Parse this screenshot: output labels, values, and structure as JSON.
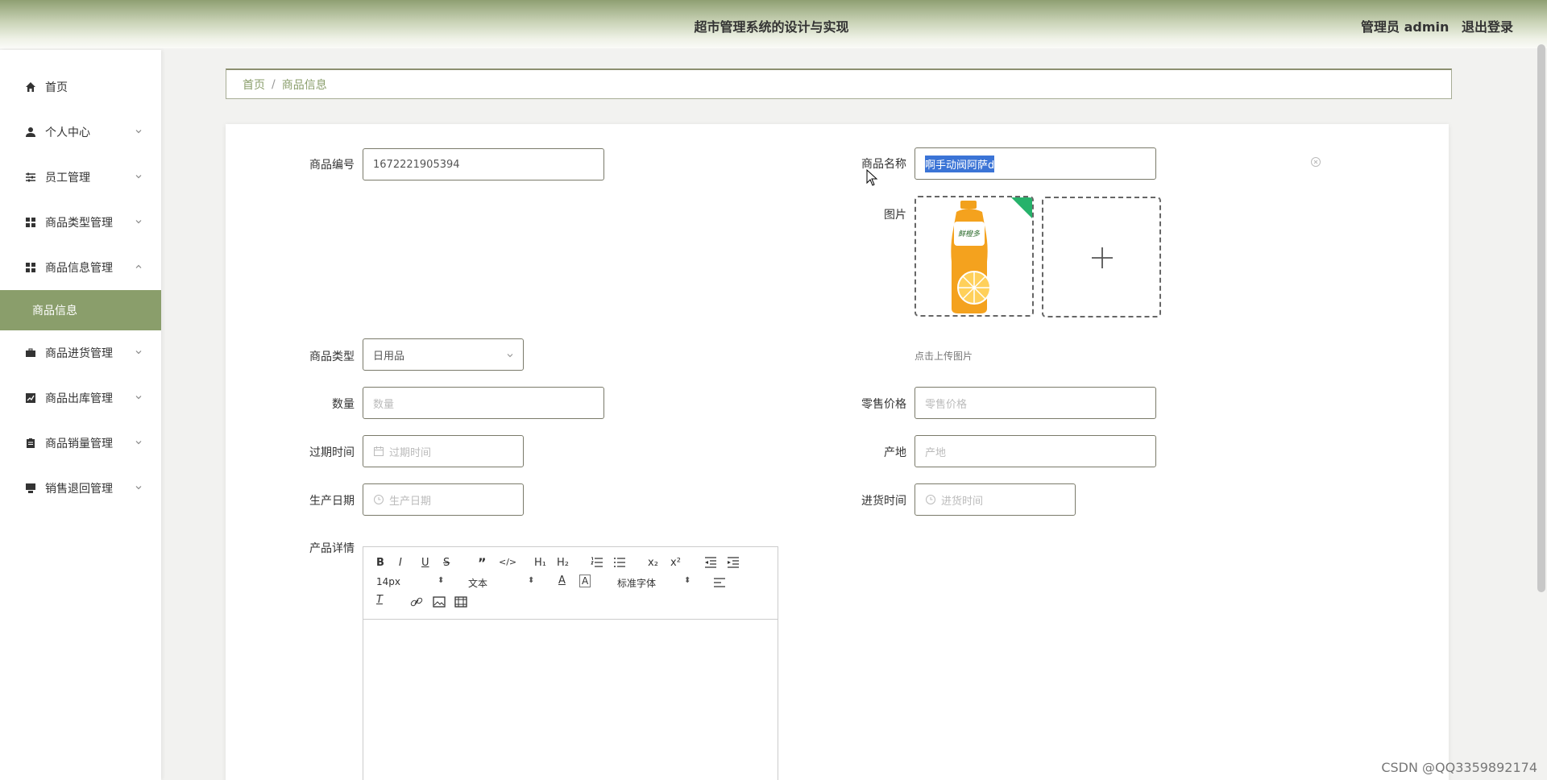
{
  "header": {
    "title": "超市管理系统的设计与实现",
    "user_role": "管理员 admin",
    "logout": "退出登录"
  },
  "sidebar": {
    "items": [
      {
        "label": "首页",
        "icon": "home-icon"
      },
      {
        "label": "个人中心",
        "icon": "person-icon"
      },
      {
        "label": "员工管理",
        "icon": "sliders-icon"
      },
      {
        "label": "商品类型管理",
        "icon": "grid-icon"
      },
      {
        "label": "商品信息管理",
        "icon": "grid-icon"
      },
      {
        "label": "商品信息",
        "icon": ""
      },
      {
        "label": "商品进货管理",
        "icon": "briefcase-icon"
      },
      {
        "label": "商品出库管理",
        "icon": "chart-icon"
      },
      {
        "label": "商品销量管理",
        "icon": "clipboard-icon"
      },
      {
        "label": "销售退回管理",
        "icon": "monitor-icon"
      }
    ]
  },
  "breadcrumb": {
    "home": "首页",
    "separator": "/",
    "current": "商品信息"
  },
  "form": {
    "product_code": {
      "label": "商品编号",
      "value": "1672221905394"
    },
    "product_name": {
      "label": "商品名称",
      "value": "啊手动阀阿萨d"
    },
    "image": {
      "label": "图片",
      "tip": "点击上传图片",
      "image_text": "鲜橙多"
    },
    "product_type": {
      "label": "商品类型",
      "value": "日用品"
    },
    "quantity": {
      "label": "数量",
      "placeholder": "数量"
    },
    "retail_price": {
      "label": "零售价格",
      "placeholder": "零售价格"
    },
    "expiry": {
      "label": "过期时间",
      "placeholder": "过期时间"
    },
    "origin": {
      "label": "产地",
      "placeholder": "产地"
    },
    "production_date": {
      "label": "生产日期",
      "placeholder": "生产日期"
    },
    "purchase_time": {
      "label": "进货时间",
      "placeholder": "进货时间"
    },
    "detail": {
      "label": "产品详情"
    }
  },
  "editor": {
    "font_size": "14px",
    "text_type": "文本",
    "font_family": "标准字体"
  },
  "watermark": "CSDN @QQ3359892174",
  "colors": {
    "accent": "#8a9e6b",
    "header_top": "#8f9f72",
    "orange": "#f4a21e"
  }
}
